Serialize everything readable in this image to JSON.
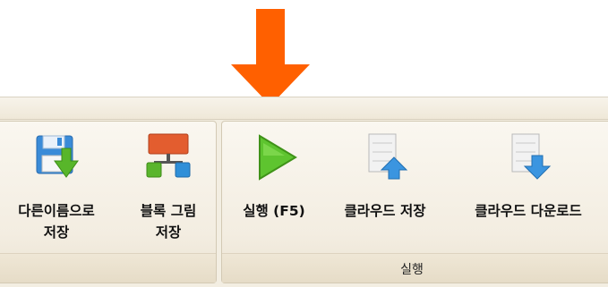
{
  "groups": [
    {
      "buttons": [
        {
          "line1": "다른이름으로",
          "line2": "저장",
          "icon": "save-as-icon"
        },
        {
          "line1": "블록 그림",
          "line2": "저장",
          "icon": "block-diagram-icon"
        }
      ]
    },
    {
      "label": "실행",
      "buttons": [
        {
          "line1": "실행 (F5)",
          "icon": "play-icon"
        },
        {
          "line1": "클라우드 저장",
          "icon": "cloud-upload-icon"
        },
        {
          "line1": "클라우드 다운로드",
          "icon": "cloud-download-icon"
        }
      ]
    }
  ],
  "annotation": {
    "icon": "down-arrow-icon",
    "color": "#ff6000"
  }
}
